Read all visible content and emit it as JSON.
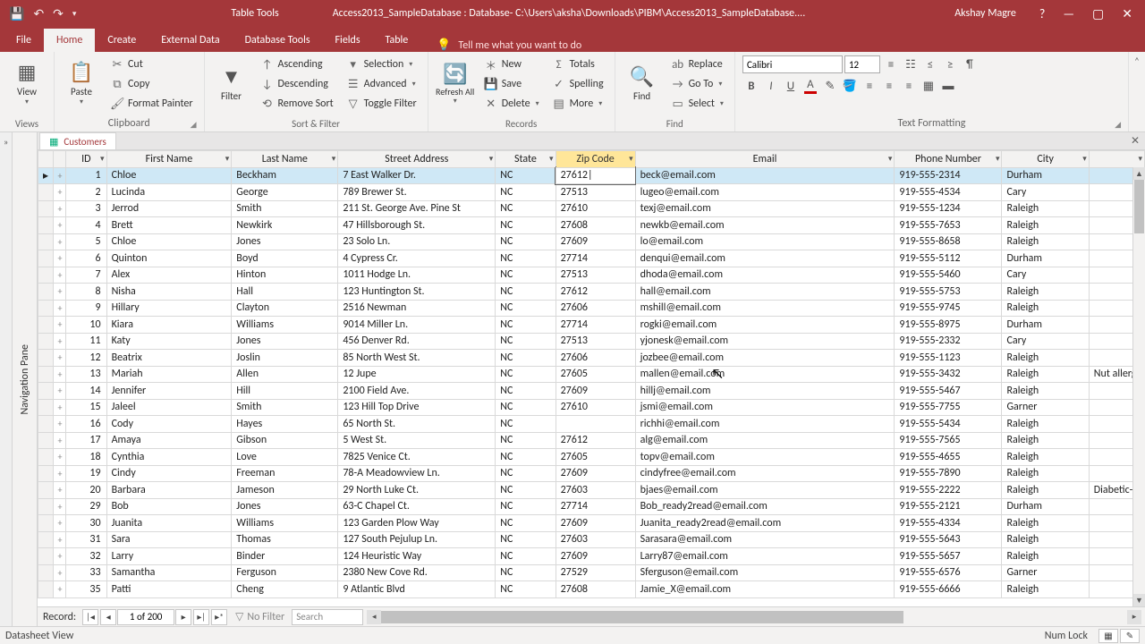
{
  "window": {
    "table_tools": "Table Tools",
    "title": "Access2013_SampleDatabase : Database- C:\\Users\\aksha\\Downloads\\PIBM\\Access2013_SampleDatabase....",
    "user": "Akshay Magre"
  },
  "tabs": {
    "file": "File",
    "home": "Home",
    "create": "Create",
    "external": "External Data",
    "dbtools": "Database Tools",
    "fields": "Fields",
    "table": "Table",
    "tell_placeholder": "Tell me what you want to do"
  },
  "ribbon": {
    "views": {
      "label": "Views",
      "view": "View"
    },
    "clipboard": {
      "label": "Clipboard",
      "paste": "Paste",
      "cut": "Cut",
      "copy": "Copy",
      "fmt": "Format Painter"
    },
    "sortfilter": {
      "label": "Sort & Filter",
      "filter": "Filter",
      "asc": "Ascending",
      "desc": "Descending",
      "remove": "Remove Sort",
      "selection": "Selection",
      "advanced": "Advanced",
      "toggle": "Toggle Filter"
    },
    "records": {
      "label": "Records",
      "refresh": "Refresh All",
      "new": "New",
      "save": "Save",
      "delete": "Delete",
      "totals": "Totals",
      "spelling": "Spelling",
      "more": "More"
    },
    "find": {
      "label": "Find",
      "find": "Find",
      "replace": "Replace",
      "goto": "Go To",
      "select": "Select"
    },
    "text": {
      "label": "Text Formatting",
      "font": "Calibri",
      "size": "12"
    }
  },
  "nav_pane_label": "Navigation Pane",
  "doc_tab": "Customers",
  "columns": [
    "ID",
    "First Name",
    "Last Name",
    "Street Address",
    "State",
    "Zip Code",
    "Email",
    "Phone Number",
    "City",
    ""
  ],
  "active_column_index": 5,
  "selected_row_index": 0,
  "editing_cell_value": "27612",
  "rows": [
    {
      "id": 1,
      "fn": "Chloe",
      "ln": "Beckham",
      "addr": "7 East Walker Dr.",
      "st": "NC",
      "zip": "27612",
      "email": "beck@email.com",
      "ph": "919-555-2314",
      "city": "Durham",
      "notes": ""
    },
    {
      "id": 2,
      "fn": "Lucinda",
      "ln": "George",
      "addr": "789 Brewer St.",
      "st": "NC",
      "zip": "27513",
      "email": "lugeo@email.com",
      "ph": "919-555-4534",
      "city": "Cary",
      "notes": ""
    },
    {
      "id": 3,
      "fn": "Jerrod",
      "ln": "Smith",
      "addr": "211 St. George Ave. Pine St",
      "st": "NC",
      "zip": "27610",
      "email": "texj@email.com",
      "ph": "919-555-1234",
      "city": "Raleigh",
      "notes": ""
    },
    {
      "id": 4,
      "fn": "Brett",
      "ln": "Newkirk",
      "addr": "47 Hillsborough St.",
      "st": "NC",
      "zip": "27608",
      "email": "newkb@email.com",
      "ph": "919-555-7653",
      "city": "Raleigh",
      "notes": ""
    },
    {
      "id": 5,
      "fn": "Chloe",
      "ln": "Jones",
      "addr": "23 Solo Ln.",
      "st": "NC",
      "zip": "27609",
      "email": "lo@email.com",
      "ph": "919-555-8658",
      "city": "Raleigh",
      "notes": ""
    },
    {
      "id": 6,
      "fn": "Quinton",
      "ln": "Boyd",
      "addr": "4 Cypress Cr.",
      "st": "NC",
      "zip": "27714",
      "email": "denqui@email.com",
      "ph": "919-555-5112",
      "city": "Durham",
      "notes": ""
    },
    {
      "id": 7,
      "fn": "Alex",
      "ln": "Hinton",
      "addr": "1011 Hodge Ln.",
      "st": "NC",
      "zip": "27513",
      "email": "dhoda@email.com",
      "ph": "919-555-5460",
      "city": "Cary",
      "notes": ""
    },
    {
      "id": 8,
      "fn": "Nisha",
      "ln": "Hall",
      "addr": "123 Huntington St.",
      "st": "NC",
      "zip": "27612",
      "email": "hall@email.com",
      "ph": "919-555-5753",
      "city": "Raleigh",
      "notes": ""
    },
    {
      "id": 9,
      "fn": "Hillary",
      "ln": "Clayton",
      "addr": "2516 Newman",
      "st": "NC",
      "zip": "27606",
      "email": "mshill@email.com",
      "ph": "919-555-9745",
      "city": "Raleigh",
      "notes": ""
    },
    {
      "id": 10,
      "fn": "Kiara",
      "ln": "Williams",
      "addr": "9014 Miller Ln.",
      "st": "NC",
      "zip": "27714",
      "email": "rogki@email.com",
      "ph": "919-555-8975",
      "city": "Durham",
      "notes": ""
    },
    {
      "id": 11,
      "fn": "Katy",
      "ln": "Jones",
      "addr": "456 Denver Rd.",
      "st": "NC",
      "zip": "27513",
      "email": "yjonesk@email.com",
      "ph": "919-555-2332",
      "city": "Cary",
      "notes": ""
    },
    {
      "id": 12,
      "fn": "Beatrix",
      "ln": "Joslin",
      "addr": "85 North West St.",
      "st": "NC",
      "zip": "27606",
      "email": "jozbee@email.com",
      "ph": "919-555-1123",
      "city": "Raleigh",
      "notes": ""
    },
    {
      "id": 13,
      "fn": "Mariah",
      "ln": "Allen",
      "addr": "12 Jupe",
      "st": "NC",
      "zip": "27605",
      "email": "mallen@email.com",
      "ph": "919-555-3432",
      "city": "Raleigh",
      "notes": "Nut allerg"
    },
    {
      "id": 14,
      "fn": "Jennifer",
      "ln": "Hill",
      "addr": "2100 Field Ave.",
      "st": "NC",
      "zip": "27609",
      "email": "hillj@email.com",
      "ph": "919-555-5467",
      "city": "Raleigh",
      "notes": ""
    },
    {
      "id": 15,
      "fn": "Jaleel",
      "ln": "Smith",
      "addr": "123 Hill Top Drive",
      "st": "NC",
      "zip": "27610",
      "email": "jsmi@email.com",
      "ph": "919-555-7755",
      "city": "Garner",
      "notes": ""
    },
    {
      "id": 16,
      "fn": "Cody",
      "ln": "Hayes",
      "addr": "65 North St.",
      "st": "NC",
      "zip": "",
      "email": "richhi@email.com",
      "ph": "919-555-5434",
      "city": "Raleigh",
      "notes": ""
    },
    {
      "id": 17,
      "fn": "Amaya",
      "ln": "Gibson",
      "addr": "5 West St.",
      "st": "NC",
      "zip": "27612",
      "email": "alg@email.com",
      "ph": "919-555-7565",
      "city": "Raleigh",
      "notes": ""
    },
    {
      "id": 18,
      "fn": "Cynthia",
      "ln": "Love",
      "addr": "7825 Venice Ct.",
      "st": "NC",
      "zip": "27605",
      "email": "topv@email.com",
      "ph": "919-555-4655",
      "city": "Raleigh",
      "notes": ""
    },
    {
      "id": 19,
      "fn": "Cindy",
      "ln": "Freeman",
      "addr": "78-A Meadowview Ln.",
      "st": "NC",
      "zip": "27609",
      "email": "cindyfree@email.com",
      "ph": "919-555-7890",
      "city": "Raleigh",
      "notes": ""
    },
    {
      "id": 20,
      "fn": "Barbara",
      "ln": "Jameson",
      "addr": "29 North Luke Ct.",
      "st": "NC",
      "zip": "27603",
      "email": "bjaes@email.com",
      "ph": "919-555-2222",
      "city": "Raleigh",
      "notes": "Diabetic- l"
    },
    {
      "id": 29,
      "fn": "Bob",
      "ln": "Jones",
      "addr": "63-C Chapel Ct.",
      "st": "NC",
      "zip": "27714",
      "email": "Bob_ready2read@email.com",
      "ph": "919-555-2121",
      "city": "Durham",
      "notes": ""
    },
    {
      "id": 30,
      "fn": "Juanita",
      "ln": "Williams",
      "addr": "123 Garden Plow Way",
      "st": "NC",
      "zip": "27609",
      "email": "Juanita_ready2read@email.com",
      "ph": "919-555-4334",
      "city": "Raleigh",
      "notes": ""
    },
    {
      "id": 31,
      "fn": "Sara",
      "ln": "Thomas",
      "addr": "127 South Pejulup Ln.",
      "st": "NC",
      "zip": "27603",
      "email": "Sarasara@email.com",
      "ph": "919-555-5643",
      "city": "Raleigh",
      "notes": ""
    },
    {
      "id": 32,
      "fn": "Larry",
      "ln": "Binder",
      "addr": "124 Heuristic Way",
      "st": "NC",
      "zip": "27609",
      "email": "Larry87@email.com",
      "ph": "919-555-5657",
      "city": "Raleigh",
      "notes": ""
    },
    {
      "id": 33,
      "fn": "Samantha",
      "ln": "Ferguson",
      "addr": "2380 New Cove Rd.",
      "st": "NC",
      "zip": "27529",
      "email": "Sferguson@email.com",
      "ph": "919-555-6576",
      "city": "Garner",
      "notes": ""
    },
    {
      "id": 35,
      "fn": "Patti",
      "ln": "Cheng",
      "addr": "9 Atlantic Blvd",
      "st": "NC",
      "zip": "27608",
      "email": "Jamie_X@email.com",
      "ph": "919-555-6666",
      "city": "Raleigh",
      "notes": ""
    }
  ],
  "record_nav": {
    "label": "Record:",
    "pos": "1 of 200",
    "nofilter": "No Filter",
    "search": "Search"
  },
  "status": {
    "view": "Datasheet View",
    "numlock": "Num Lock"
  }
}
